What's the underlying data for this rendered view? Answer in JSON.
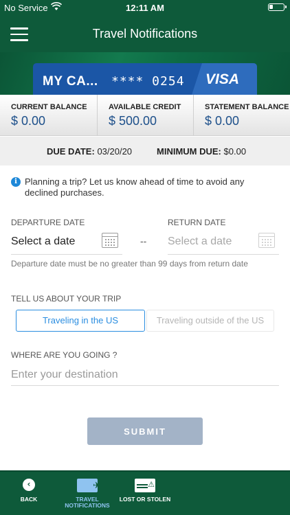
{
  "status_bar": {
    "carrier": "No Service",
    "time": "12:11 AM"
  },
  "header": {
    "title": "Travel Notifications"
  },
  "card": {
    "name": "MY CA...",
    "masked_number": "**** 0254",
    "brand": "VISA"
  },
  "summary": {
    "items": [
      {
        "label": "CURRENT BALANCE",
        "value": "$ 0.00"
      },
      {
        "label": "AVAILABLE CREDIT",
        "value": "$ 500.00"
      },
      {
        "label": "STATEMENT BALANCE",
        "value": "$ 0.00"
      }
    ]
  },
  "due": {
    "due_label": "DUE DATE:",
    "due_value": "03/20/20",
    "min_label": "MINIMUM DUE:",
    "min_value": "$0.00"
  },
  "info": {
    "text": "Planning a trip? Let us know ahead of time to avoid any declined purchases."
  },
  "dates": {
    "departure_label": "DEPARTURE DATE",
    "departure_value": "Select a date",
    "separator": "--",
    "return_label": "RETURN DATE",
    "return_value": "Select a date",
    "hint": "Departure date must be no greater than 99 days from return date"
  },
  "trip": {
    "label": "TELL US ABOUT YOUR TRIP",
    "options": [
      "Traveling in the US",
      "Traveling outside of the US"
    ],
    "selected": "Traveling in the US"
  },
  "destination": {
    "label": "WHERE ARE YOU GOING ?",
    "placeholder": "Enter your destination",
    "value": ""
  },
  "submit_label": "SUBMIT",
  "bottom_nav": {
    "back": "BACK",
    "travel": "TRAVEL NOTIFICATIONS",
    "lost": "LOST OR STOLEN"
  },
  "colors": {
    "brand_green": "#0e5a3a",
    "accent_blue": "#2a8de0",
    "card_blue": "#1b56a6"
  }
}
